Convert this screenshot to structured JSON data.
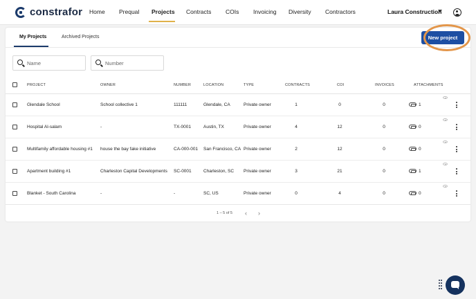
{
  "app": {
    "brand": "constrafor",
    "nav": [
      {
        "label": "Home",
        "active": false
      },
      {
        "label": "Prequal",
        "active": false
      },
      {
        "label": "Projects",
        "active": true
      },
      {
        "label": "Contracts",
        "active": false
      },
      {
        "label": "COIs",
        "active": false
      },
      {
        "label": "Invoicing",
        "active": false
      },
      {
        "label": "Diversity",
        "active": false
      },
      {
        "label": "Contractors",
        "active": false
      }
    ],
    "user": "Laura Construction"
  },
  "tabs": [
    {
      "label": "My Projects",
      "active": true
    },
    {
      "label": "Archived Projects",
      "active": false
    }
  ],
  "actions": {
    "new_project": "New project"
  },
  "filters": {
    "name_placeholder": "Name",
    "number_placeholder": "Number"
  },
  "table": {
    "columns": [
      "PROJECT",
      "OWNER",
      "NUMBER",
      "LOCATION",
      "TYPE",
      "CONTRACTS",
      "COI",
      "INVOICES",
      "ATTACHMENTS"
    ],
    "rows": [
      {
        "project": "Glendale School",
        "owner": "School collective 1",
        "number": "111111",
        "location": "Glendale, CA",
        "type": "Private owner",
        "contracts": "1",
        "coi": "0",
        "invoices": "0",
        "attachments": "1"
      },
      {
        "project": "Hospital Al-salam",
        "owner": "-",
        "number": "TX-0001",
        "location": "Austin, TX",
        "type": "Private owner",
        "contracts": "4",
        "coi": "12",
        "invoices": "0",
        "attachments": "0"
      },
      {
        "project": "Multifamily affordable housing #1",
        "owner": "house the bay fake initiative",
        "number": "CA-000-001",
        "location": "San Francisco, CA",
        "type": "Private owner",
        "contracts": "2",
        "coi": "12",
        "invoices": "0",
        "attachments": "0"
      },
      {
        "project": "Apartment building #1",
        "owner": "Charleston Capital Developments",
        "number": "SC-0001",
        "location": "Charleston, SC",
        "type": "Private owner",
        "contracts": "3",
        "coi": "21",
        "invoices": "0",
        "attachments": "1"
      },
      {
        "project": "Blanket - South Carolina",
        "owner": "-",
        "number": "-",
        "location": "SC, US",
        "type": "Private owner",
        "contracts": "0",
        "coi": "4",
        "invoices": "0",
        "attachments": "0"
      }
    ]
  },
  "pagination": {
    "summary": "1 – 5 of 5"
  },
  "colors": {
    "primary": "#1d4fa3",
    "brand_dark": "#1b3a6b",
    "highlight": "#e3964a",
    "nav_underline": "#e0b24a"
  }
}
